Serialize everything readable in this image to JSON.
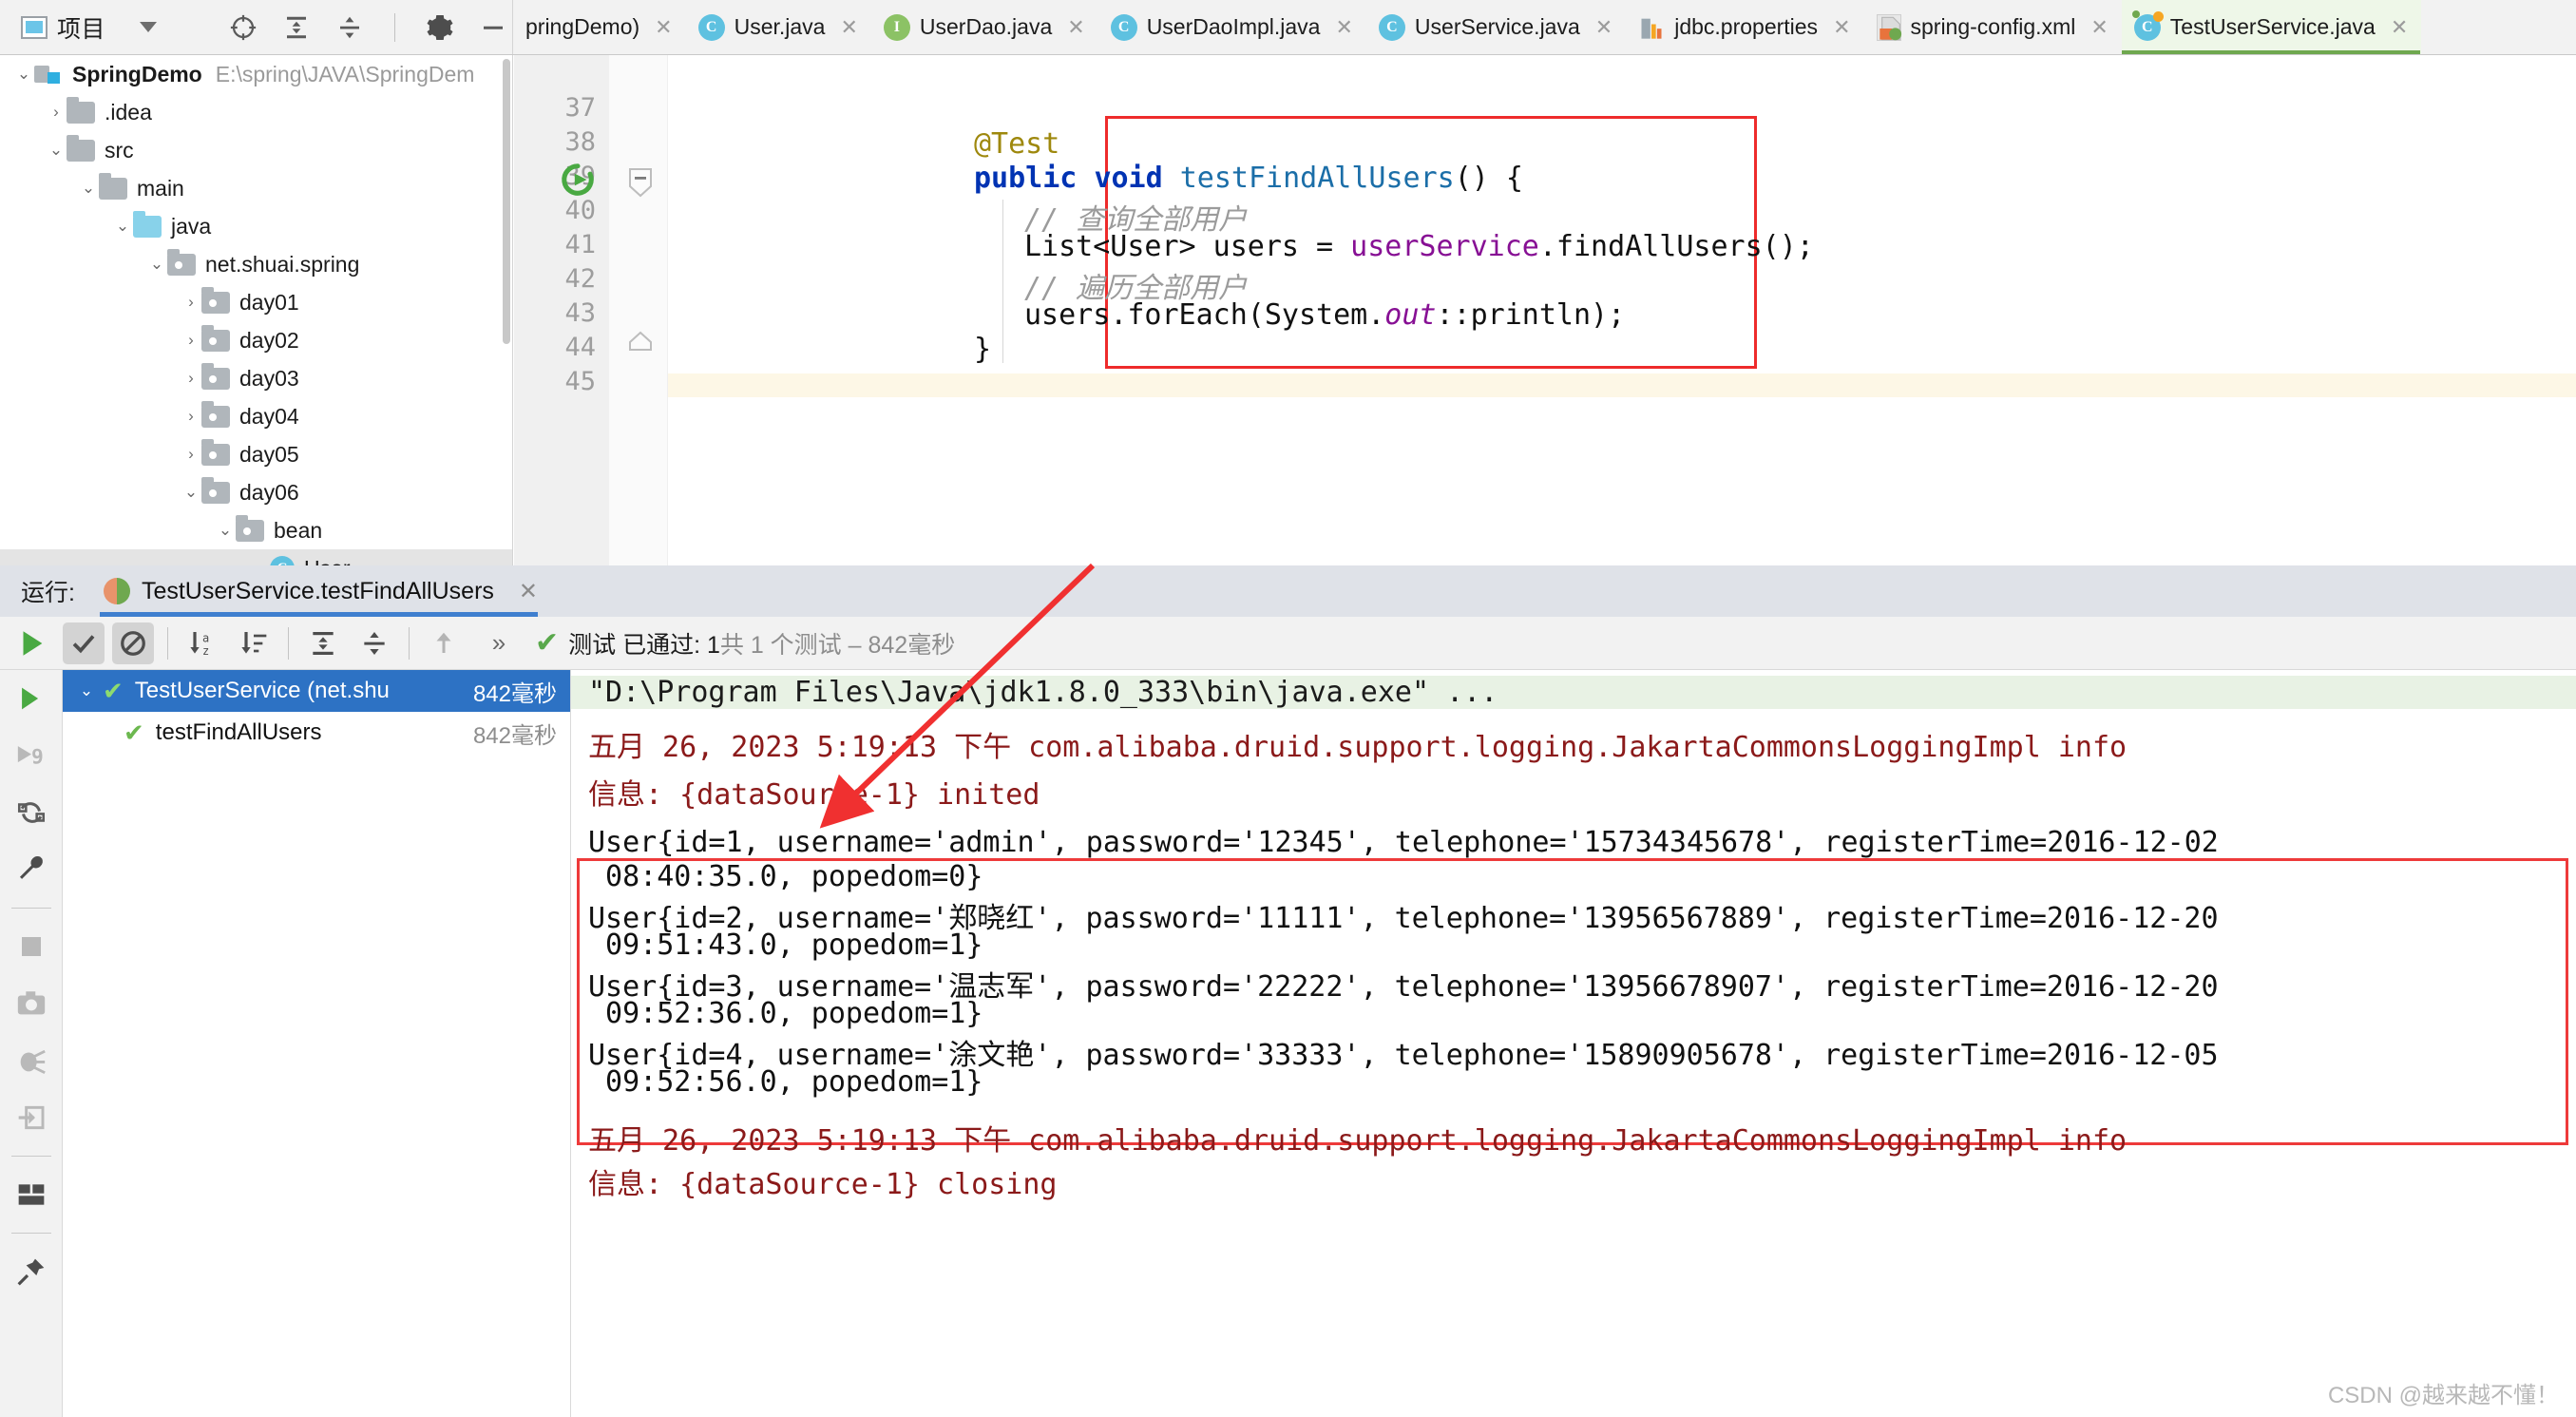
{
  "window": {
    "project_tool_title": "项目",
    "toolbar_icons": [
      "locate-icon",
      "expand-all-icon",
      "collapse-all-icon",
      "gear-icon",
      "minimize-icon"
    ]
  },
  "editor_tabs": [
    {
      "label": "pringDemo)",
      "icon": "none",
      "active": false,
      "truncated": true
    },
    {
      "label": "User.java",
      "icon": "class-icon",
      "active": false
    },
    {
      "label": "UserDao.java",
      "icon": "interface-icon",
      "active": false
    },
    {
      "label": "UserDaoImpl.java",
      "icon": "class-icon",
      "active": false
    },
    {
      "label": "UserService.java",
      "icon": "class-icon",
      "active": false
    },
    {
      "label": "jdbc.properties",
      "icon": "properties-icon",
      "active": false
    },
    {
      "label": "spring-config.xml",
      "icon": "xml-icon",
      "active": false
    },
    {
      "label": "TestUserService.java",
      "icon": "test-class-icon",
      "active": true
    }
  ],
  "project_tree": [
    {
      "label": "SpringDemo",
      "path": "E:\\spring\\JAVA\\SpringDem",
      "depth": 0,
      "state": "expanded",
      "icon": "module-icon",
      "bold": true
    },
    {
      "label": ".idea",
      "depth": 1,
      "state": "collapsed",
      "icon": "folder-grey"
    },
    {
      "label": "src",
      "depth": 1,
      "state": "expanded",
      "icon": "folder-grey"
    },
    {
      "label": "main",
      "depth": 2,
      "state": "expanded",
      "icon": "folder-grey"
    },
    {
      "label": "java",
      "depth": 3,
      "state": "expanded",
      "icon": "folder-blue"
    },
    {
      "label": "net.shuai.spring",
      "depth": 4,
      "state": "expanded",
      "icon": "package-icon"
    },
    {
      "label": "day01",
      "depth": 5,
      "state": "collapsed",
      "icon": "package-icon"
    },
    {
      "label": "day02",
      "depth": 5,
      "state": "collapsed",
      "icon": "package-icon"
    },
    {
      "label": "day03",
      "depth": 5,
      "state": "collapsed",
      "icon": "package-icon"
    },
    {
      "label": "day04",
      "depth": 5,
      "state": "collapsed",
      "icon": "package-icon"
    },
    {
      "label": "day05",
      "depth": 5,
      "state": "collapsed",
      "icon": "package-icon"
    },
    {
      "label": "day06",
      "depth": 5,
      "state": "expanded",
      "icon": "package-icon"
    },
    {
      "label": "bean",
      "depth": 6,
      "state": "expanded",
      "icon": "package-icon"
    },
    {
      "label": "User",
      "depth": 7,
      "state": "leaf",
      "icon": "class-icon",
      "selected": true
    }
  ],
  "code": {
    "line_numbers": [
      "37",
      "38",
      "39",
      "40",
      "41",
      "42",
      "43",
      "44",
      "45"
    ],
    "lines": [
      {
        "n": 38,
        "text": "@Test"
      },
      {
        "n": 39,
        "text": "public void testFindAllUsers() {"
      },
      {
        "n": 40,
        "text": "// 查询全部用户"
      },
      {
        "n": 41,
        "text": "List<User> users = userService.findAllUsers();"
      },
      {
        "n": 42,
        "text": "// 遍历全部用户"
      },
      {
        "n": 43,
        "text": "users.forEach(System.out::println);"
      },
      {
        "n": 44,
        "text": "}"
      }
    ],
    "gutter_run_icon": "run-test-icon",
    "fold_icon": "fold-minus-icon"
  },
  "run_panel": {
    "run_label": "运行:",
    "tab_title": "TestUserService.testFindAllUsers",
    "tab_close": "✕",
    "status_prefix": "测试 已通过: ",
    "status_count": "1",
    "status_middle": "共 1 个测试 – 842毫秒",
    "toolbar_icons": [
      "show-passed-icon",
      "hide-ignored-icon",
      "sort-alpha-icon",
      "sort-duration-icon",
      "expand-all-icon",
      "collapse-all-icon",
      "prev-occurrence-icon",
      "more-icon"
    ],
    "side_icons": [
      "rerun-icon",
      "rerun-failed-icon",
      "toggle-auto-test-icon",
      "settings-wrench-icon",
      "stop-icon",
      "screenshot-icon",
      "debug-icon",
      "export-icon",
      "layout-icon",
      "pin-icon"
    ],
    "test_tree": [
      {
        "label": "TestUserService (net.shu",
        "duration": "842毫秒",
        "state": "passed",
        "selected": true,
        "expanded": true
      },
      {
        "label": "testFindAllUsers",
        "duration": "842毫秒",
        "state": "passed",
        "selected": false,
        "child": true
      }
    ]
  },
  "console": {
    "command_line": "\"D:\\Program Files\\Java\\jdk1.8.0_333\\bin\\java.exe\" ...",
    "log_line_1": "五月 26, 2023 5:19:13 下午 com.alibaba.druid.support.logging.JakartaCommonsLoggingImpl info",
    "log_line_2": "信息: {dataSource-1} inited",
    "users": [
      {
        "l1": "User{id=1, username='admin', password='12345', telephone='15734345678', registerTime=2016-12-02",
        "l2": " 08:40:35.0, popedom=0}"
      },
      {
        "l1": "User{id=2, username='郑晓红', password='11111', telephone='13956567889', registerTime=2016-12-20",
        "l2": " 09:51:43.0, popedom=1}"
      },
      {
        "l1": "User{id=3, username='温志军', password='22222', telephone='13956678907', registerTime=2016-12-20",
        "l2": " 09:52:36.0, popedom=1}"
      },
      {
        "l1": "User{id=4, username='涂文艳', password='33333', telephone='15890905678', registerTime=2016-12-05",
        "l2": " 09:52:56.0, popedom=1}"
      }
    ],
    "log_line_3": "五月 26, 2023 5:19:13 下午 com.alibaba.druid.support.logging.JakartaCommonsLoggingImpl info",
    "log_line_4": "信息: {dataSource-1} closing"
  },
  "annotations": {
    "highlight_color": "#ee2b2b",
    "arrow_color": "#f03030"
  },
  "watermark": "CSDN @越来越不懂！"
}
